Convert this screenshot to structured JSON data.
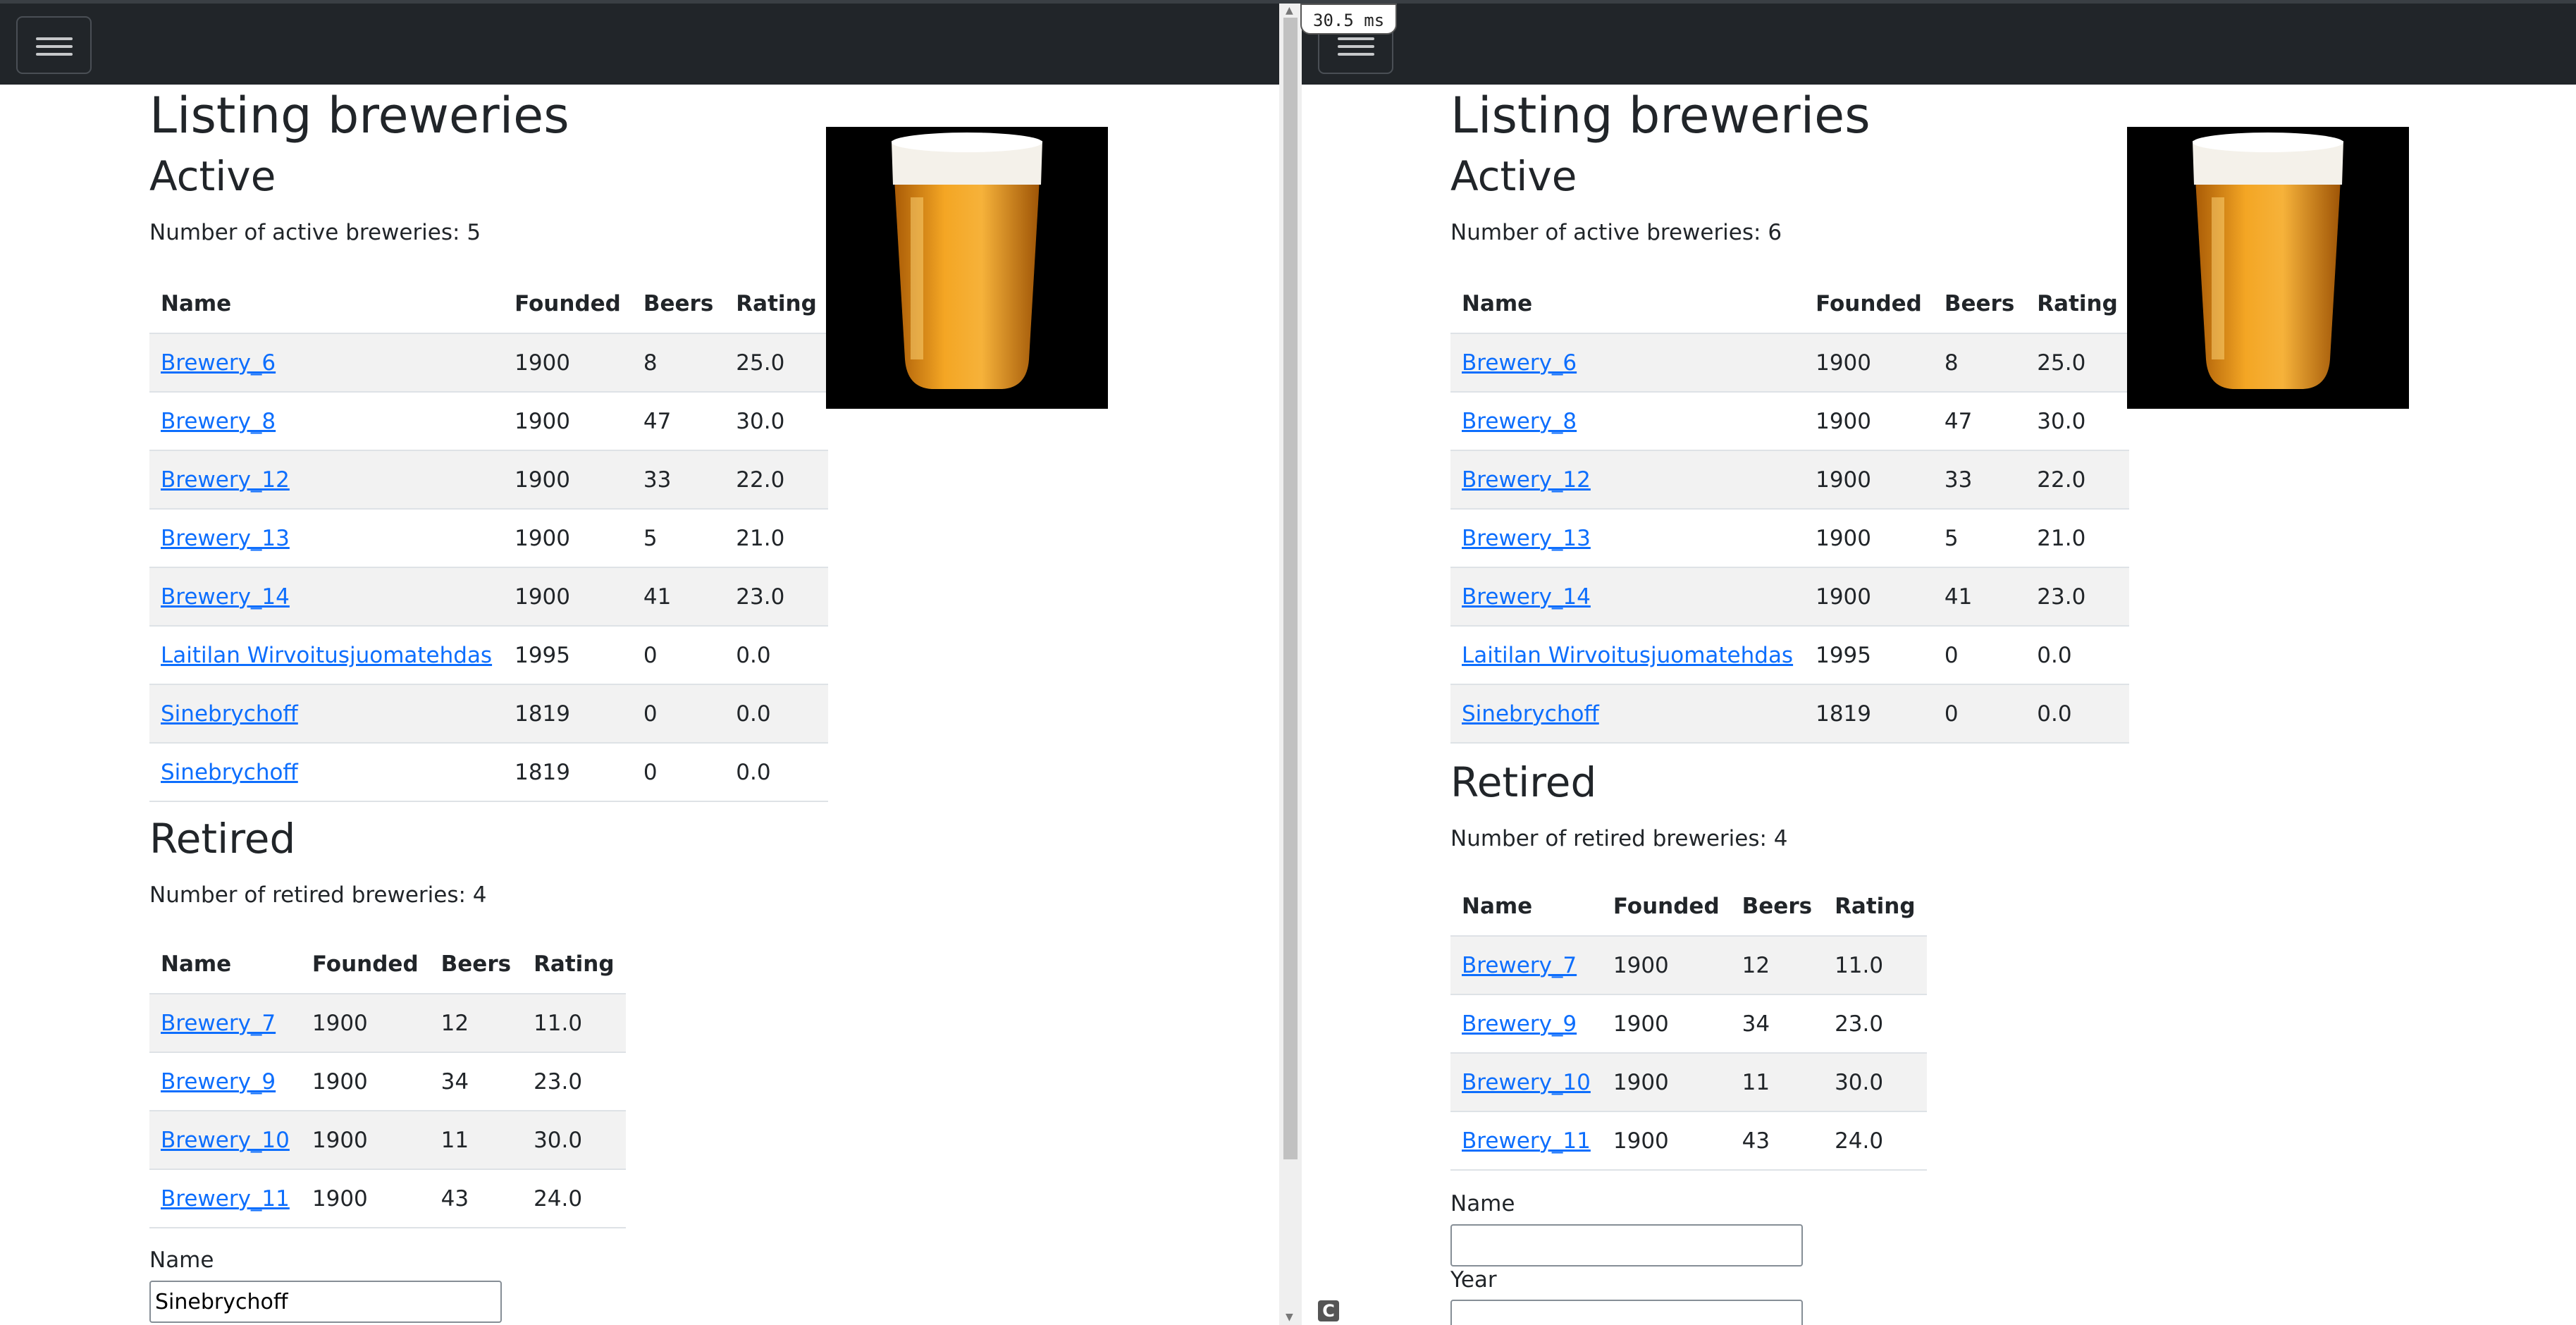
{
  "timing": "30.5 ms",
  "c_badge": "C",
  "left": {
    "title": "Listing breweries",
    "active_heading": "Active",
    "active_count": "Number of active breweries: 5",
    "table_headers": [
      "Name",
      "Founded",
      "Beers",
      "Rating"
    ],
    "active_rows": [
      [
        "Brewery_6",
        "1900",
        "8",
        "25.0"
      ],
      [
        "Brewery_8",
        "1900",
        "47",
        "30.0"
      ],
      [
        "Brewery_12",
        "1900",
        "33",
        "22.0"
      ],
      [
        "Brewery_13",
        "1900",
        "5",
        "21.0"
      ],
      [
        "Brewery_14",
        "1900",
        "41",
        "23.0"
      ],
      [
        "Laitilan Wirvoitusjuomatehdas",
        "1995",
        "0",
        "0.0"
      ],
      [
        "Sinebrychoff",
        "1819",
        "0",
        "0.0"
      ],
      [
        "Sinebrychoff",
        "1819",
        "0",
        "0.0"
      ]
    ],
    "retired_heading": "Retired",
    "retired_count": "Number of retired breweries: 4",
    "retired_rows": [
      [
        "Brewery_7",
        "1900",
        "12",
        "11.0"
      ],
      [
        "Brewery_9",
        "1900",
        "34",
        "23.0"
      ],
      [
        "Brewery_10",
        "1900",
        "11",
        "30.0"
      ],
      [
        "Brewery_11",
        "1900",
        "43",
        "24.0"
      ]
    ],
    "form": {
      "name_label": "Name",
      "name_value": "Sinebrychoff"
    }
  },
  "right": {
    "title": "Listing breweries",
    "active_heading": "Active",
    "active_count": "Number of active breweries: 6",
    "table_headers": [
      "Name",
      "Founded",
      "Beers",
      "Rating"
    ],
    "active_rows": [
      [
        "Brewery_6",
        "1900",
        "8",
        "25.0"
      ],
      [
        "Brewery_8",
        "1900",
        "47",
        "30.0"
      ],
      [
        "Brewery_12",
        "1900",
        "33",
        "22.0"
      ],
      [
        "Brewery_13",
        "1900",
        "5",
        "21.0"
      ],
      [
        "Brewery_14",
        "1900",
        "41",
        "23.0"
      ],
      [
        "Laitilan Wirvoitusjuomatehdas",
        "1995",
        "0",
        "0.0"
      ],
      [
        "Sinebrychoff",
        "1819",
        "0",
        "0.0"
      ]
    ],
    "retired_heading": "Retired",
    "retired_count": "Number of retired breweries: 4",
    "retired_rows": [
      [
        "Brewery_7",
        "1900",
        "12",
        "11.0"
      ],
      [
        "Brewery_9",
        "1900",
        "34",
        "23.0"
      ],
      [
        "Brewery_10",
        "1900",
        "11",
        "30.0"
      ],
      [
        "Brewery_11",
        "1900",
        "43",
        "24.0"
      ]
    ],
    "form": {
      "name_label": "Name",
      "name_value": "",
      "year_label": "Year",
      "year_value": ""
    }
  }
}
